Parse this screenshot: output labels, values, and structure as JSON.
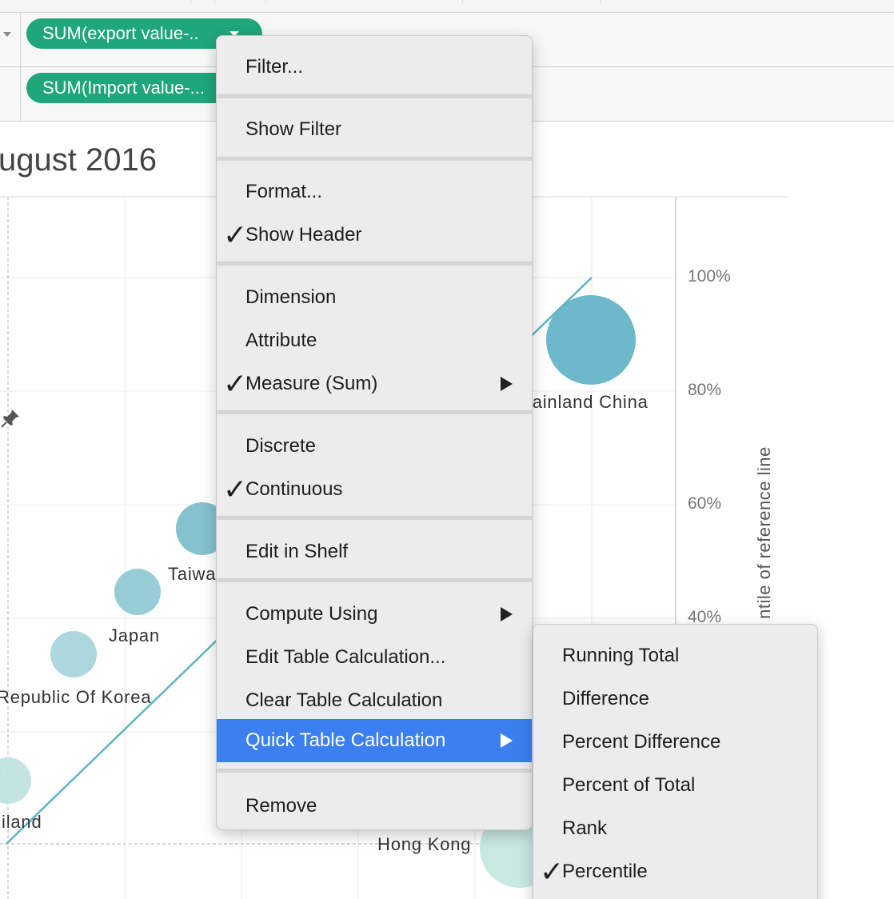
{
  "shelves": {
    "columns_pill": "SUM(export value-..",
    "rows_pill": "SUM(Import value-..."
  },
  "viz": {
    "title_fragment": "ugust 2016",
    "axis_ticks": [
      "100%",
      "80%",
      "60%",
      "40%"
    ],
    "axis_title_fragment": "ntile of reference line",
    "mark_labels": {
      "china": "lainland China",
      "taiwan": "Taiwa",
      "japan": "Japan",
      "korea": "Republic Of Korea",
      "thailand": "iland",
      "hongkong": "Hong Kong"
    },
    "colors": {
      "mark": "#5aaec4",
      "mark_light": "#a9d8da",
      "trend": "#5fb3c0"
    }
  },
  "context_menu": {
    "items": {
      "filter": "Filter...",
      "show_filter": "Show Filter",
      "format": "Format...",
      "show_header": "Show Header",
      "dimension": "Dimension",
      "attribute": "Attribute",
      "measure": "Measure (Sum)",
      "discrete": "Discrete",
      "continuous": "Continuous",
      "edit_in_shelf": "Edit in Shelf",
      "compute_using": "Compute Using",
      "edit_table_calc": "Edit Table Calculation...",
      "clear_table_calc": "Clear Table Calculation",
      "quick_table_calc": "Quick Table Calculation",
      "remove": "Remove"
    },
    "checkmark": "✓",
    "highlight_color": "#3b7ff0"
  },
  "submenu": {
    "items": {
      "running_total": "Running Total",
      "difference": "Difference",
      "percent_difference": "Percent Difference",
      "percent_of_total": "Percent of Total",
      "rank": "Rank",
      "percentile": "Percentile"
    }
  }
}
